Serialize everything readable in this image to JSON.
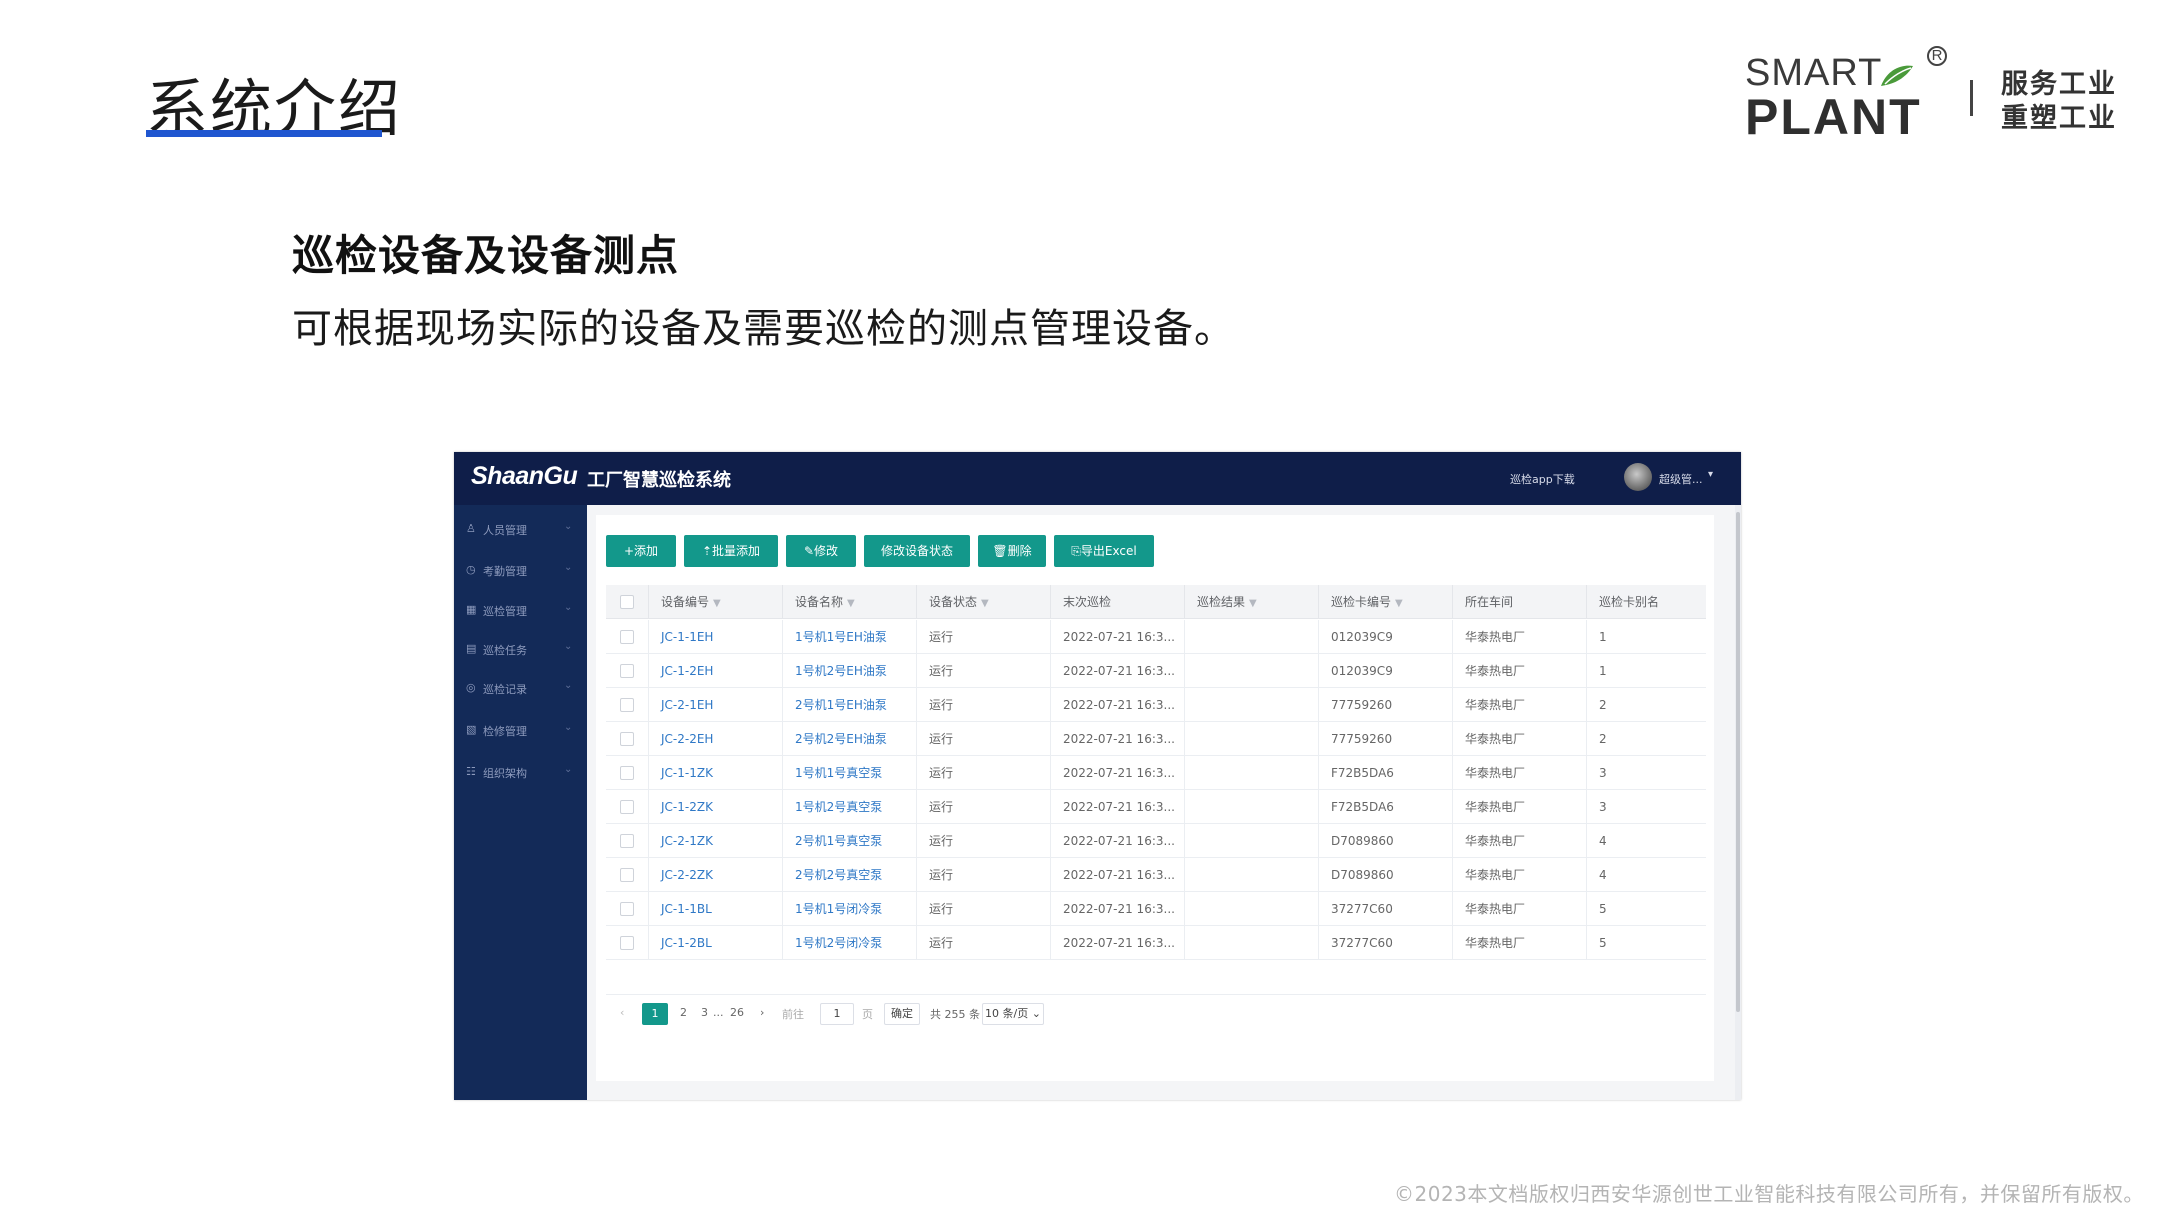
{
  "slide": {
    "title": "系统介绍",
    "section_heading": "巡检设备及设备测点",
    "section_desc": "可根据现场实际的设备及需要巡检的测点管理设备。",
    "footer": "©2023本文档版权归西安华源创世工业智能科技有限公司所有，并保留所有版权。"
  },
  "logo": {
    "smart": "SMART",
    "plant": "PLANT",
    "reg": "R",
    "slogan_line1": "服务工业",
    "slogan_line2": "重塑工业"
  },
  "app": {
    "brand": "ShaanGu",
    "system_name": "工厂智慧巡检系统",
    "download": "巡检app下载",
    "user": "超级管...",
    "user_caret": "▾"
  },
  "sidebar": {
    "items": [
      {
        "label": "人员管理",
        "icon": "user-icon",
        "glyph": "♙"
      },
      {
        "label": "考勤管理",
        "icon": "clock-icon",
        "glyph": "◷"
      },
      {
        "label": "巡检管理",
        "icon": "grid-icon",
        "glyph": "▦"
      },
      {
        "label": "巡检任务",
        "icon": "task-icon",
        "glyph": "▤"
      },
      {
        "label": "巡检记录",
        "icon": "record-icon",
        "glyph": "◎"
      },
      {
        "label": "检修管理",
        "icon": "repair-icon",
        "glyph": "▧"
      },
      {
        "label": "组织架构",
        "icon": "org-icon",
        "glyph": "☷"
      }
    ],
    "chevron": "⌄"
  },
  "toolbar": {
    "add": "+添加",
    "batch_add": "⇡批量添加",
    "edit": "✎修改",
    "change_status": "修改设备状态",
    "delete": "🗑删除",
    "export": "⎘导出Excel"
  },
  "table": {
    "columns": [
      "设备编号",
      "设备名称",
      "设备状态",
      "末次巡检",
      "巡检结果",
      "巡检卡编号",
      "所在车间",
      "巡检卡别名"
    ],
    "filter_glyph": "▼",
    "rows": [
      [
        "JC-1-1EH",
        "1号机1号EH油泵",
        "运行",
        "2022-07-21 16:3...",
        "",
        "012039C9",
        "华泰热电厂",
        "1"
      ],
      [
        "JC-1-2EH",
        "1号机2号EH油泵",
        "运行",
        "2022-07-21 16:3...",
        "",
        "012039C9",
        "华泰热电厂",
        "1"
      ],
      [
        "JC-2-1EH",
        "2号机1号EH油泵",
        "运行",
        "2022-07-21 16:3...",
        "",
        "77759260",
        "华泰热电厂",
        "2"
      ],
      [
        "JC-2-2EH",
        "2号机2号EH油泵",
        "运行",
        "2022-07-21 16:3...",
        "",
        "77759260",
        "华泰热电厂",
        "2"
      ],
      [
        "JC-1-1ZK",
        "1号机1号真空泵",
        "运行",
        "2022-07-21 16:3...",
        "",
        "F72B5DA6",
        "华泰热电厂",
        "3"
      ],
      [
        "JC-1-2ZK",
        "1号机2号真空泵",
        "运行",
        "2022-07-21 16:3...",
        "",
        "F72B5DA6",
        "华泰热电厂",
        "3"
      ],
      [
        "JC-2-1ZK",
        "2号机1号真空泵",
        "运行",
        "2022-07-21 16:3...",
        "",
        "D7089860",
        "华泰热电厂",
        "4"
      ],
      [
        "JC-2-2ZK",
        "2号机2号真空泵",
        "运行",
        "2022-07-21 16:3...",
        "",
        "D7089860",
        "华泰热电厂",
        "4"
      ],
      [
        "JC-1-1BL",
        "1号机1号闭冷泵",
        "运行",
        "2022-07-21 16:3...",
        "",
        "37277C60",
        "华泰热电厂",
        "5"
      ],
      [
        "JC-1-2BL",
        "1号机2号闭冷泵",
        "运行",
        "2022-07-21 16:3...",
        "",
        "37277C60",
        "华泰热电厂",
        "5"
      ]
    ]
  },
  "pagination": {
    "prev": "‹",
    "pages": [
      "1",
      "2",
      "3",
      "...",
      "26"
    ],
    "next": "›",
    "goto_label": "前往",
    "goto_value": "1",
    "page_unit": "页",
    "confirm": "确定",
    "total": "共 255 条",
    "page_size": "10 条/页 ⌄"
  },
  "colors": {
    "accent": "#13988b",
    "header_bg": "#0f1e49",
    "sidebar_bg": "#132a58",
    "title_underline": "#1f56d0",
    "link": "#2f78c6"
  }
}
